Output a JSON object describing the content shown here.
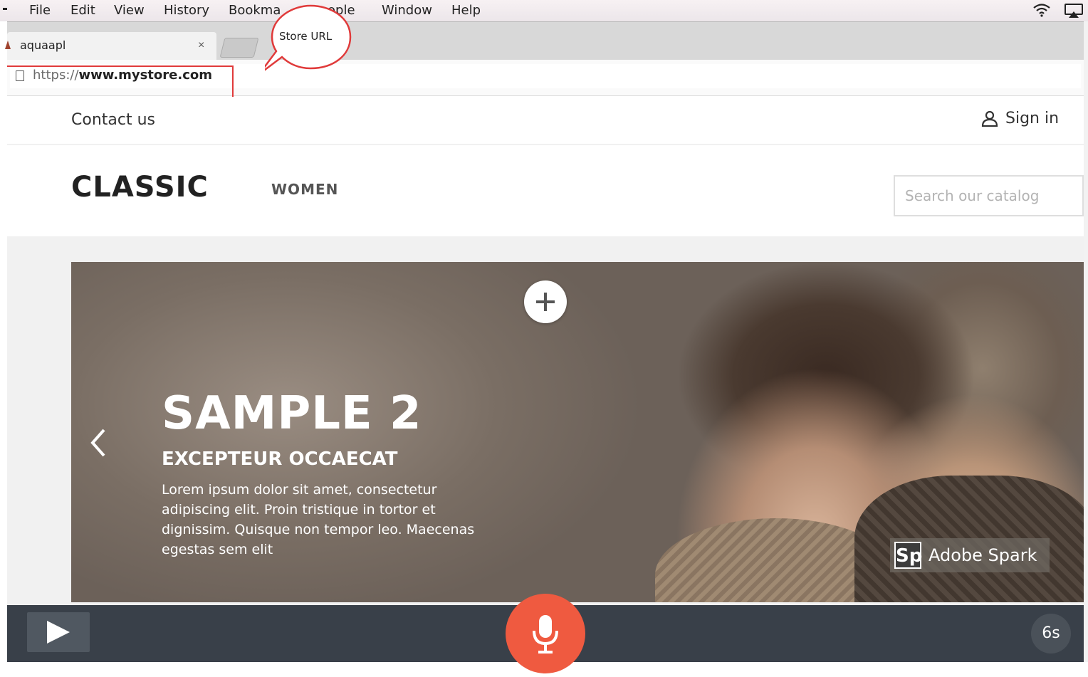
{
  "menubar": {
    "apple_fragment": "",
    "items": [
      "File",
      "Edit",
      "View",
      "History",
      "Bookma",
      "ople",
      "Window",
      "Help"
    ]
  },
  "browser": {
    "tab_title": "aquaapl",
    "tab_close": "×",
    "url_scheme": "https://",
    "url_host": "www.mystore.com"
  },
  "callout": {
    "text": "Store URL"
  },
  "store": {
    "contact_label": "Contact us",
    "signin_label": "Sign in",
    "logo": "CLASSIC",
    "nav": {
      "women": "WOMEN"
    },
    "search": {
      "placeholder": "Search our catalog"
    }
  },
  "hero": {
    "title": "SAMPLE 2",
    "subtitle": "EXCEPTEUR OCCAECAT",
    "body": "Lorem ipsum dolor sit amet, consectetur adipiscing elit. Proin tristique in tortor et dignissim. Quisque non tempor leo. Maecenas egestas sem elit",
    "plus_icon": "plus-icon",
    "prev_icon": "chevron-left-icon"
  },
  "watermark": {
    "logo_letters": "Sp",
    "text": "Adobe Spark"
  },
  "recorder": {
    "timer": "6s",
    "accent": "#ef5a40",
    "bar_color": "#394049"
  },
  "colors": {
    "highlight": "#e03a3a"
  }
}
